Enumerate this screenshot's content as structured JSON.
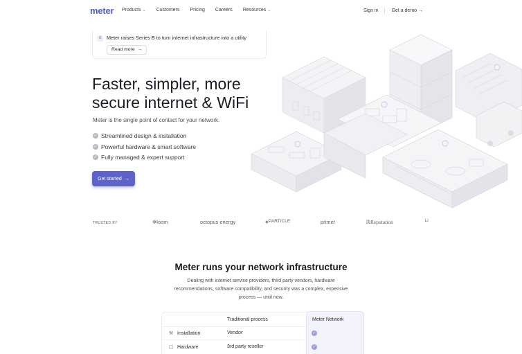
{
  "nav": {
    "logo": "meter",
    "links": [
      {
        "label": "Products",
        "dropdown": true
      },
      {
        "label": "Customers",
        "dropdown": false
      },
      {
        "label": "Pricing",
        "dropdown": false
      },
      {
        "label": "Careers",
        "dropdown": false
      },
      {
        "label": "Resources",
        "dropdown": true
      }
    ],
    "sign_in": "Sign in",
    "demo": "Get a demo",
    "demo_arrow": "→"
  },
  "announcement": {
    "text": "Meter raises Series B to turn internet infrastructure into a utility",
    "read_more": "Read more",
    "arrow": "→"
  },
  "hero": {
    "title_line1": "Faster, simpler, more",
    "title_line2": "secure internet & WiFi",
    "subtitle": "Meter is the single point of contact for your network.",
    "features": [
      "Streamlined design & installation",
      "Powerful hardware & smart software",
      "Fully managed & expert support"
    ],
    "cta": "Get started",
    "cta_arrow": "→"
  },
  "trusted": {
    "label": "TRUSTED BY",
    "logos": [
      "loom",
      "octopus energy",
      "PARTICLE",
      "primer",
      "Reputation",
      "Li"
    ]
  },
  "section": {
    "title": "Meter runs your network infrastructure",
    "body": "Dealing with internet service providers, third party vendors, hardware recommendations, software compatibility, and security was a complex, expensive process — until now."
  },
  "comparison": {
    "col_traditional": "Traditional process",
    "col_meter": "Meter Network",
    "rows": [
      {
        "label": "Installation",
        "traditional": "Vendor",
        "meter": true,
        "icon": "wrench-icon"
      },
      {
        "label": "Hardware",
        "traditional": "3rd party reseller",
        "meter": true,
        "icon": "box-icon"
      }
    ]
  },
  "colors": {
    "brand": "#5160c8",
    "cta": "#5d63c8",
    "text": "#1b1b24"
  }
}
